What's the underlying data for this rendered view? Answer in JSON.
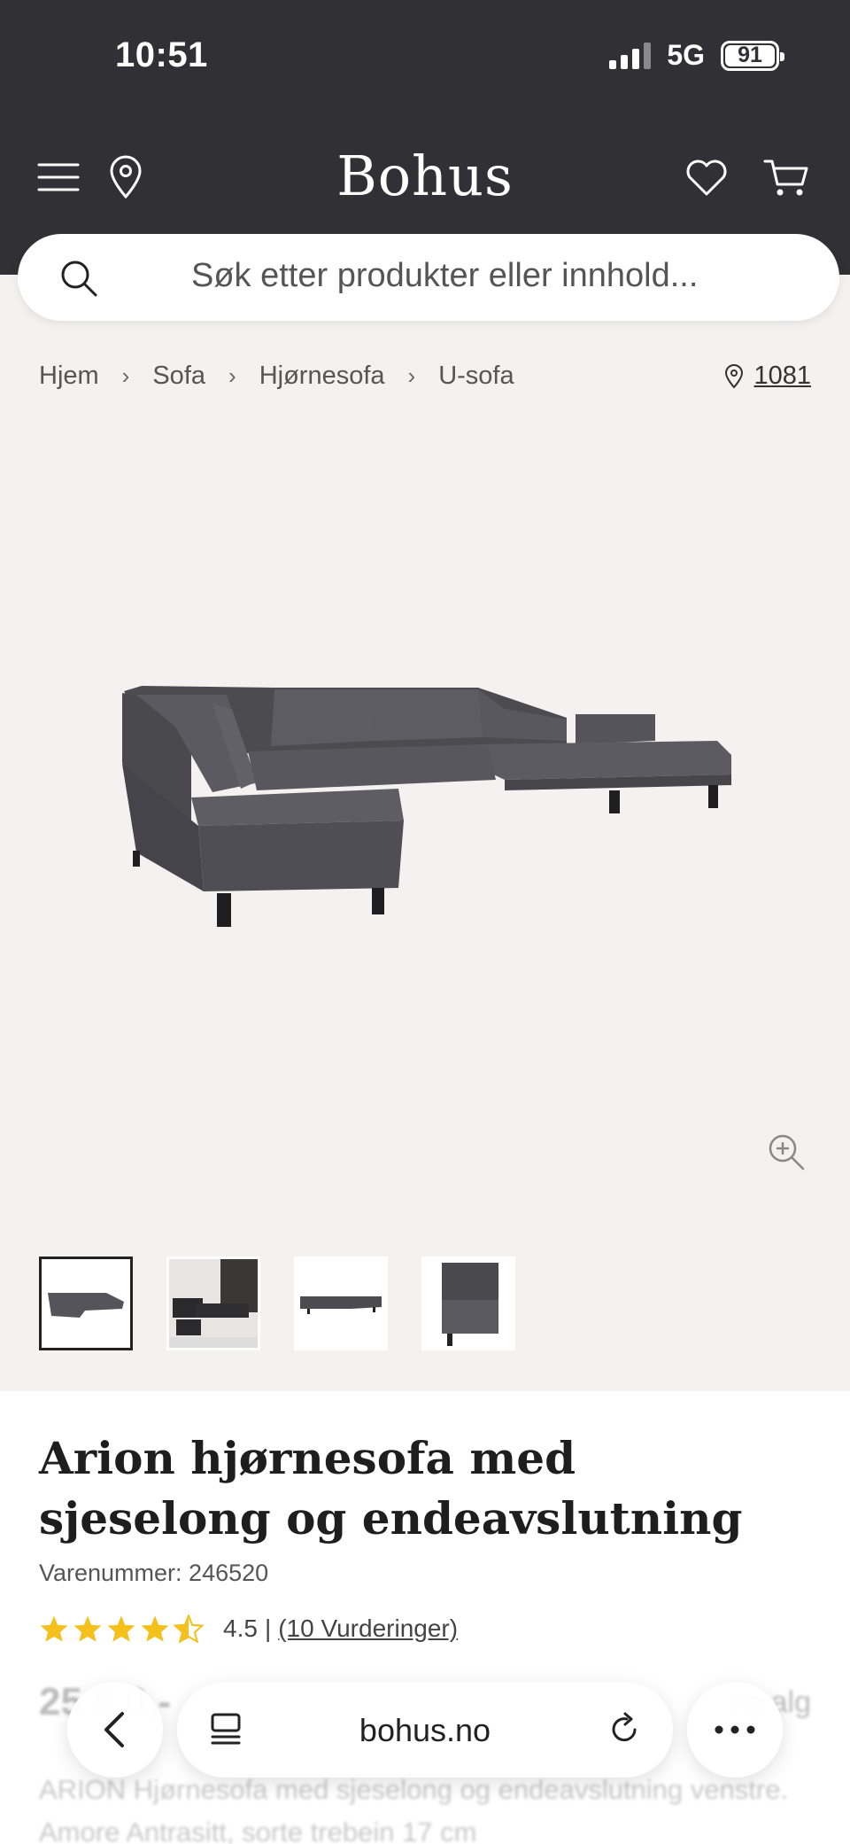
{
  "status_bar": {
    "time": "10:51",
    "network": "5G",
    "battery": "91"
  },
  "header": {
    "brand": "Bohus",
    "icons": [
      "menu-icon",
      "location-pin-icon",
      "heart-icon",
      "cart-icon"
    ]
  },
  "search": {
    "placeholder": "Søk etter produkter eller innhold..."
  },
  "breadcrumb": [
    "Hjem",
    "Sofa",
    "Hjørnesofa",
    "U-sofa"
  ],
  "store_link": "1081",
  "product": {
    "title": "Arion hjørnesofa med sjeselong og endeavslutning",
    "sku": "Varenummer: 246520",
    "rating": 4.5,
    "rating_text": "4.5",
    "review_count": "(10 Vurderinger)",
    "price_partial": "25 9 0,-",
    "right_partial": "ng alg",
    "description_partial": "ARION Hjørnesofa med sjeselong og endeavslutning venstre. Amore Antrasitt, sorte trebein 17 cm"
  },
  "gallery": {
    "thumbnail_count": 4,
    "selected_index": 0
  },
  "browser_bar": {
    "url": "bohus.no"
  },
  "colors": {
    "header_bg": "#313034",
    "page_bg": "#f3f2f1",
    "star": "#f3c01c",
    "sofa": "#55545a"
  }
}
